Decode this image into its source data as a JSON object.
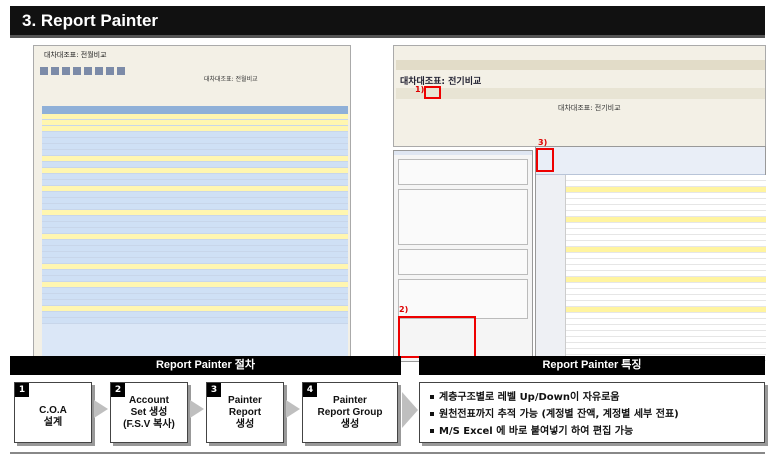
{
  "title": "3. Report Painter",
  "left_window": {
    "title": "대차대조표: 전월비교",
    "header_left": [
      "",
      "",
      ""
    ],
    "header_right": [
      "대차대조표: 전월비교",
      "",
      ""
    ]
  },
  "right_window": {
    "title": "대차대조표: 전기비교",
    "info_left": [
      "",
      "",
      ""
    ],
    "info_right": [
      "대차대조표: 전기비교",
      "",
      ""
    ]
  },
  "callouts": {
    "one": "1)",
    "two": "2)",
    "three": "3)"
  },
  "dialog": {
    "options": [
      "",
      "",
      ""
    ]
  },
  "sections": {
    "procedure": "Report Painter 절차",
    "features": "Report Painter 특징"
  },
  "steps": [
    {
      "number": "1",
      "label": "C.O.A\n설계"
    },
    {
      "number": "2",
      "label": "Account\nSet 생성\n(F.S.V 복사)"
    },
    {
      "number": "3",
      "label": "Painter\nReport\n생성"
    },
    {
      "number": "4",
      "label": "Painter\nReport Group\n생성"
    }
  ],
  "features": [
    "계층구조별로 레벨 Up/Down이 자유로움",
    "원천전표까지 추적 가능 (계정별 잔액, 계정별 세부 전표)",
    "M/S Excel 에 바로 붙여넣기 하여 편집 가능"
  ]
}
